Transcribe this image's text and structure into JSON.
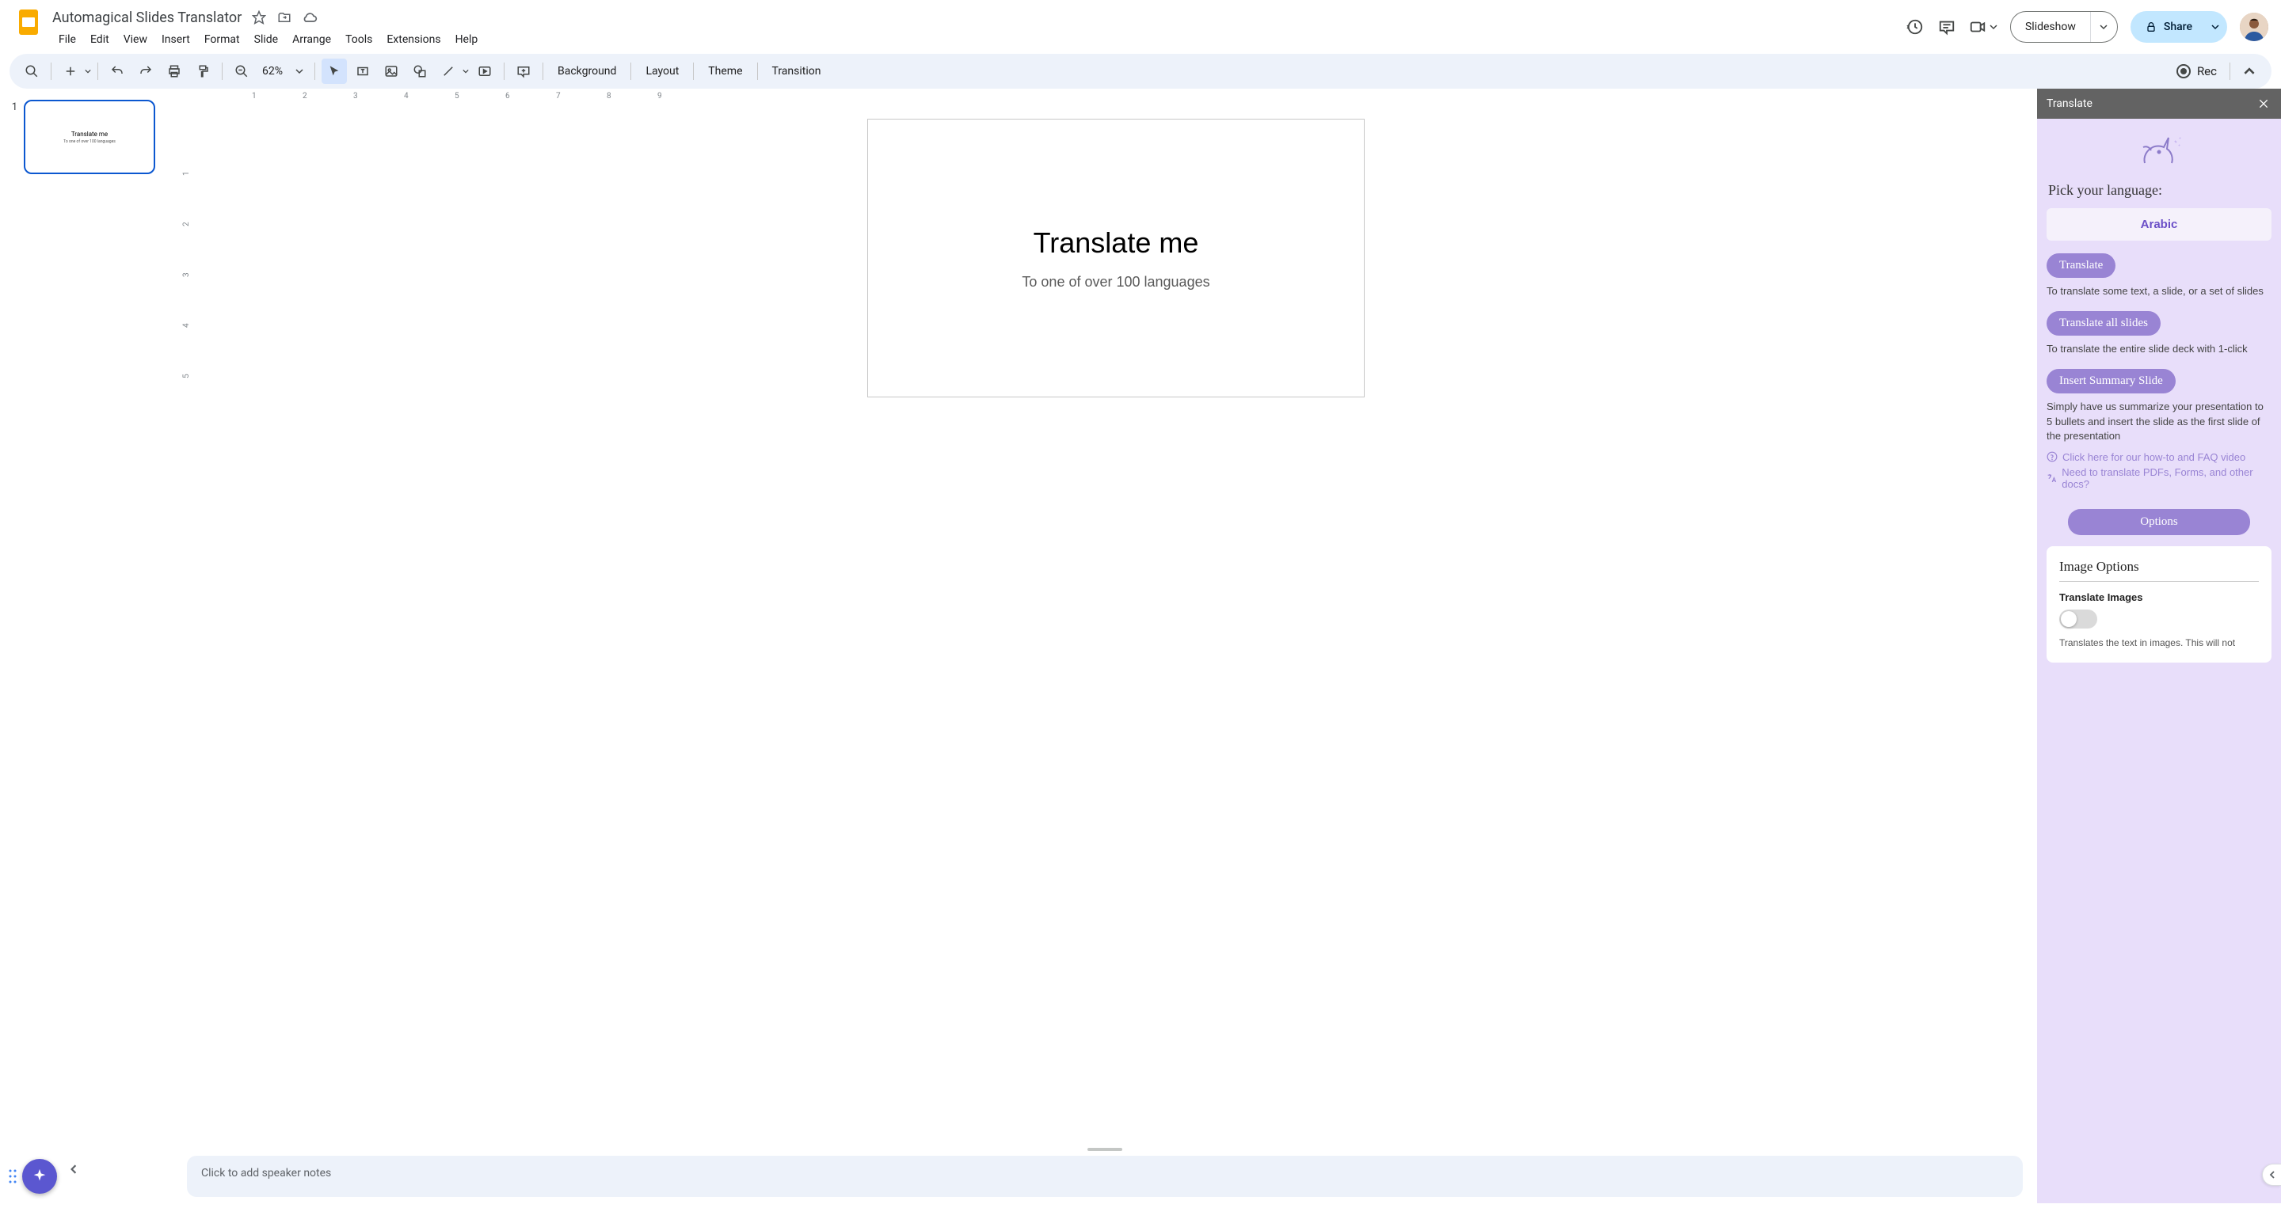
{
  "header": {
    "doc_title": "Automagical Slides Translator",
    "menus": [
      "File",
      "Edit",
      "View",
      "Insert",
      "Format",
      "Slide",
      "Arrange",
      "Tools",
      "Extensions",
      "Help"
    ],
    "slideshow_label": "Slideshow",
    "share_label": "Share"
  },
  "toolbar": {
    "zoom": "62%",
    "background": "Background",
    "layout": "Layout",
    "theme": "Theme",
    "transition": "Transition",
    "rec": "Rec"
  },
  "filmstrip": {
    "slides": [
      {
        "num": "1",
        "title": "Translate me",
        "sub": "To one of over 100 languages"
      }
    ]
  },
  "canvas": {
    "title": "Translate me",
    "subtitle": "To one of over 100 languages"
  },
  "ruler_h": [
    "1",
    "2",
    "3",
    "4",
    "5",
    "6",
    "7",
    "8",
    "9"
  ],
  "ruler_v": [
    "1",
    "2",
    "3",
    "4",
    "5"
  ],
  "notes": {
    "placeholder": "Click to add speaker notes"
  },
  "panel": {
    "title": "Translate",
    "pick_label": "Pick your language:",
    "language": "Arabic",
    "btn_translate": "Translate",
    "desc_translate": "To translate some text, a slide, or a set of slides",
    "btn_all": "Translate all slides",
    "desc_all": "To translate the entire slide deck with 1-click",
    "btn_summary": "Insert Summary Slide",
    "desc_summary": "Simply have us summarize your presentation to 5 bullets and insert the slide as the first slide of the presentation",
    "link_faq": "Click here for our how-to and FAQ video",
    "link_docs": "Need to translate PDFs, Forms, and other docs?",
    "options_header": "Options",
    "card_title": "Image Options",
    "toggle_label": "Translate Images",
    "toggle_desc": "Translates the text in images. This will not"
  }
}
